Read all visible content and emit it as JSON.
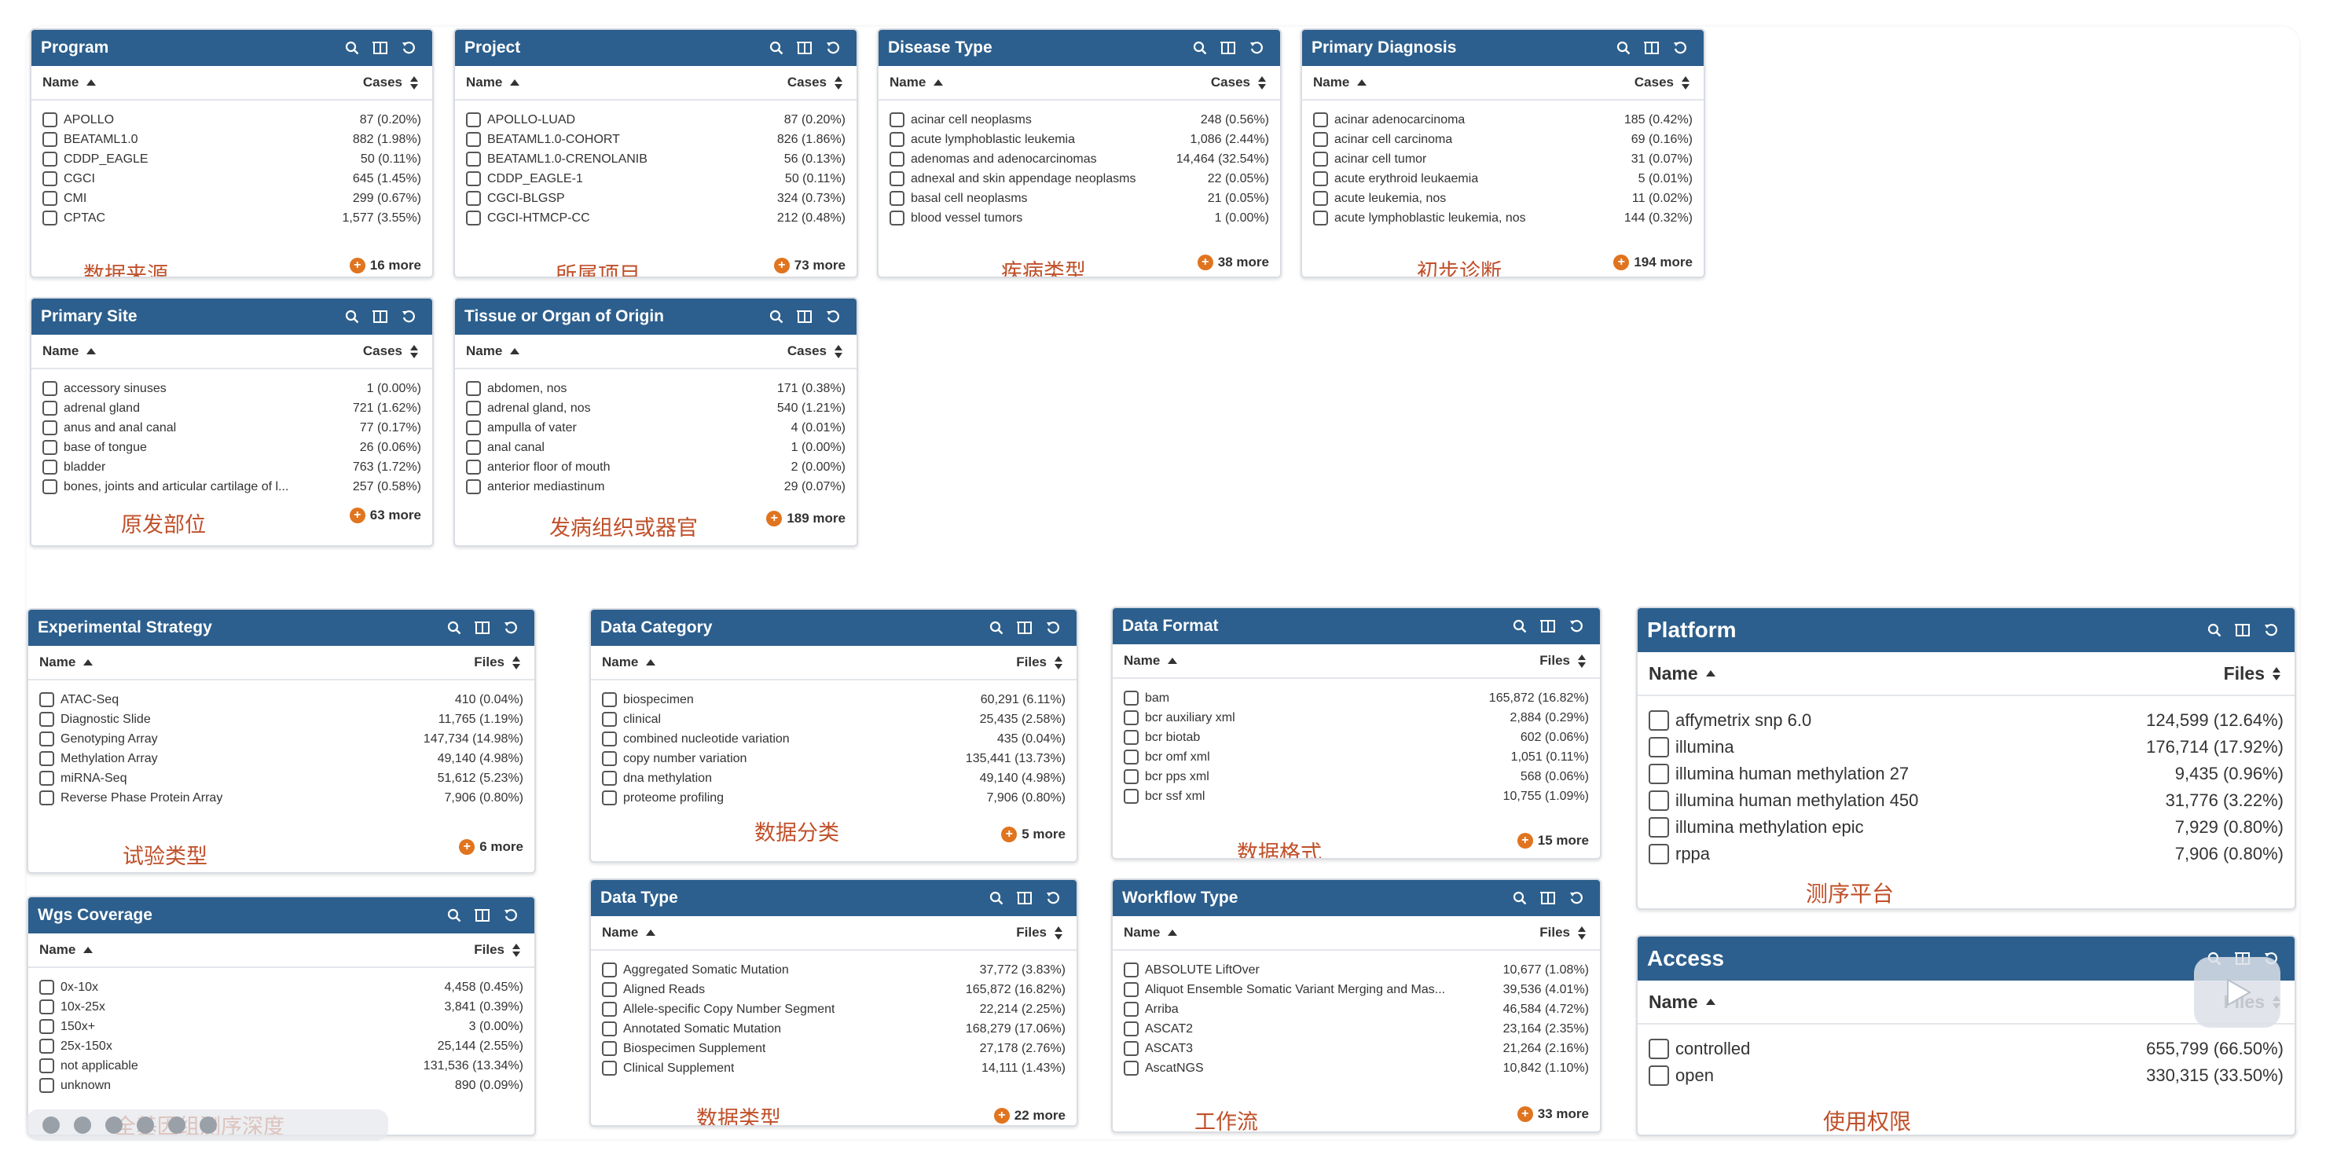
{
  "cards": {
    "program": {
      "title": "Program",
      "col_name": "Name",
      "col_count": "Cases",
      "rows": [
        {
          "name": "APOLLO",
          "count": "87 (0.20%)"
        },
        {
          "name": "BEATAML1.0",
          "count": "882 (1.98%)"
        },
        {
          "name": "CDDP_EAGLE",
          "count": "50 (0.11%)"
        },
        {
          "name": "CGCI",
          "count": "645 (1.45%)"
        },
        {
          "name": "CMI",
          "count": "299 (0.67%)"
        },
        {
          "name": "CPTAC",
          "count": "1,577 (3.55%)"
        }
      ],
      "more": "16 more",
      "annotation": "数据来源"
    },
    "project": {
      "title": "Project",
      "col_name": "Name",
      "col_count": "Cases",
      "rows": [
        {
          "name": "APOLLO-LUAD",
          "count": "87 (0.20%)"
        },
        {
          "name": "BEATAML1.0-COHORT",
          "count": "826 (1.86%)"
        },
        {
          "name": "BEATAML1.0-CRENOLANIB",
          "count": "56 (0.13%)"
        },
        {
          "name": "CDDP_EAGLE-1",
          "count": "50 (0.11%)"
        },
        {
          "name": "CGCI-BLGSP",
          "count": "324 (0.73%)"
        },
        {
          "name": "CGCI-HTMCP-CC",
          "count": "212 (0.48%)"
        }
      ],
      "more": "73 more",
      "annotation": "所属项目"
    },
    "disease_type": {
      "title": "Disease Type",
      "col_name": "Name",
      "col_count": "Cases",
      "rows": [
        {
          "name": "acinar cell neoplasms",
          "count": "248 (0.56%)"
        },
        {
          "name": "acute lymphoblastic leukemia",
          "count": "1,086 (2.44%)"
        },
        {
          "name": "adenomas and adenocarcinomas",
          "count": "14,464 (32.54%)"
        },
        {
          "name": "adnexal and skin appendage neoplasms",
          "count": "22 (0.05%)"
        },
        {
          "name": "basal cell neoplasms",
          "count": "21 (0.05%)"
        },
        {
          "name": "blood vessel tumors",
          "count": "1 (0.00%)"
        }
      ],
      "more": "38 more",
      "annotation": "疾病类型"
    },
    "primary_diagnosis": {
      "title": "Primary Diagnosis",
      "col_name": "Name",
      "col_count": "Cases",
      "rows": [
        {
          "name": "acinar adenocarcinoma",
          "count": "185 (0.42%)"
        },
        {
          "name": "acinar cell carcinoma",
          "count": "69 (0.16%)"
        },
        {
          "name": "acinar cell tumor",
          "count": "31 (0.07%)"
        },
        {
          "name": "acute erythroid leukaemia",
          "count": "5 (0.01%)"
        },
        {
          "name": "acute leukemia, nos",
          "count": "11 (0.02%)"
        },
        {
          "name": "acute lymphoblastic leukemia, nos",
          "count": "144 (0.32%)"
        }
      ],
      "more": "194 more",
      "annotation": "初步诊断"
    },
    "primary_site": {
      "title": "Primary Site",
      "col_name": "Name",
      "col_count": "Cases",
      "rows": [
        {
          "name": "accessory sinuses",
          "count": "1 (0.00%)"
        },
        {
          "name": "adrenal gland",
          "count": "721 (1.62%)"
        },
        {
          "name": "anus and anal canal",
          "count": "77 (0.17%)"
        },
        {
          "name": "base of tongue",
          "count": "26 (0.06%)"
        },
        {
          "name": "bladder",
          "count": "763 (1.72%)"
        },
        {
          "name": "bones, joints and articular cartilage of l...",
          "count": "257 (0.58%)"
        }
      ],
      "more": "63 more",
      "annotation": "原发部位"
    },
    "tissue_origin": {
      "title": "Tissue or Organ of Origin",
      "col_name": "Name",
      "col_count": "Cases",
      "rows": [
        {
          "name": "abdomen, nos",
          "count": "171 (0.38%)"
        },
        {
          "name": "adrenal gland, nos",
          "count": "540 (1.21%)"
        },
        {
          "name": "ampulla of vater",
          "count": "4 (0.01%)"
        },
        {
          "name": "anal canal",
          "count": "1 (0.00%)"
        },
        {
          "name": "anterior floor of mouth",
          "count": "2 (0.00%)"
        },
        {
          "name": "anterior mediastinum",
          "count": "29 (0.07%)"
        }
      ],
      "more": "189 more",
      "annotation": "发病组织或器官"
    },
    "experimental_strategy": {
      "title": "Experimental Strategy",
      "col_name": "Name",
      "col_count": "Files",
      "rows": [
        {
          "name": "ATAC-Seq",
          "count": "410 (0.04%)"
        },
        {
          "name": "Diagnostic Slide",
          "count": "11,765 (1.19%)"
        },
        {
          "name": "Genotyping Array",
          "count": "147,734 (14.98%)"
        },
        {
          "name": "Methylation Array",
          "count": "49,140 (4.98%)"
        },
        {
          "name": "miRNA-Seq",
          "count": "51,612 (5.23%)"
        },
        {
          "name": "Reverse Phase Protein Array",
          "count": "7,906 (0.80%)"
        }
      ],
      "more": "6 more",
      "annotation": "试验类型"
    },
    "data_category": {
      "title": "Data Category",
      "col_name": "Name",
      "col_count": "Files",
      "rows": [
        {
          "name": "biospecimen",
          "count": "60,291 (6.11%)"
        },
        {
          "name": "clinical",
          "count": "25,435 (2.58%)"
        },
        {
          "name": "combined nucleotide variation",
          "count": "435 (0.04%)"
        },
        {
          "name": "copy number variation",
          "count": "135,441 (13.73%)"
        },
        {
          "name": "dna methylation",
          "count": "49,140 (4.98%)"
        },
        {
          "name": "proteome profiling",
          "count": "7,906 (0.80%)"
        }
      ],
      "more": "5 more",
      "annotation": "数据分类"
    },
    "data_format": {
      "title": "Data Format",
      "col_name": "Name",
      "col_count": "Files",
      "rows": [
        {
          "name": "bam",
          "count": "165,872 (16.82%)"
        },
        {
          "name": "bcr auxiliary xml",
          "count": "2,884 (0.29%)"
        },
        {
          "name": "bcr biotab",
          "count": "602 (0.06%)"
        },
        {
          "name": "bcr omf xml",
          "count": "1,051 (0.11%)"
        },
        {
          "name": "bcr pps xml",
          "count": "568 (0.06%)"
        },
        {
          "name": "bcr ssf xml",
          "count": "10,755 (1.09%)"
        }
      ],
      "more": "15 more",
      "annotation": "数据格式"
    },
    "platform": {
      "title": "Platform",
      "col_name": "Name",
      "col_count": "Files",
      "rows": [
        {
          "name": "affymetrix snp 6.0",
          "count": "124,599 (12.64%)"
        },
        {
          "name": "illumina",
          "count": "176,714 (17.92%)"
        },
        {
          "name": "illumina human methylation 27",
          "count": "9,435 (0.96%)"
        },
        {
          "name": "illumina human methylation 450",
          "count": "31,776 (3.22%)"
        },
        {
          "name": "illumina methylation epic",
          "count": "7,929 (0.80%)"
        },
        {
          "name": "rppa",
          "count": "7,906 (0.80%)"
        }
      ],
      "annotation": "测序平台"
    },
    "wgs_coverage": {
      "title": "Wgs Coverage",
      "col_name": "Name",
      "col_count": "Files",
      "rows": [
        {
          "name": "0x-10x",
          "count": "4,458 (0.45%)"
        },
        {
          "name": "10x-25x",
          "count": "3,841 (0.39%)"
        },
        {
          "name": "150x+",
          "count": "3 (0.00%)"
        },
        {
          "name": "25x-150x",
          "count": "25,144 (2.55%)"
        },
        {
          "name": "not applicable",
          "count": "131,536 (13.34%)"
        },
        {
          "name": "unknown",
          "count": "890 (0.09%)"
        }
      ],
      "annotation": "全基因组测序深度"
    },
    "data_type": {
      "title": "Data Type",
      "col_name": "Name",
      "col_count": "Files",
      "rows": [
        {
          "name": "Aggregated Somatic Mutation",
          "count": "37,772 (3.83%)"
        },
        {
          "name": "Aligned Reads",
          "count": "165,872 (16.82%)"
        },
        {
          "name": "Allele-specific Copy Number Segment",
          "count": "22,214 (2.25%)"
        },
        {
          "name": "Annotated Somatic Mutation",
          "count": "168,279 (17.06%)"
        },
        {
          "name": "Biospecimen Supplement",
          "count": "27,178 (2.76%)"
        },
        {
          "name": "Clinical Supplement",
          "count": "14,111 (1.43%)"
        }
      ],
      "more": "22 more",
      "annotation": "数据类型"
    },
    "workflow_type": {
      "title": "Workflow Type",
      "col_name": "Name",
      "col_count": "Files",
      "rows": [
        {
          "name": "ABSOLUTE LiftOver",
          "count": "10,677 (1.08%)"
        },
        {
          "name": "Aliquot Ensemble Somatic Variant Merging and Mas...",
          "count": "39,536 (4.01%)"
        },
        {
          "name": "Arriba",
          "count": "46,584 (4.72%)"
        },
        {
          "name": "ASCAT2",
          "count": "23,164 (2.35%)"
        },
        {
          "name": "ASCAT3",
          "count": "21,264 (2.16%)"
        },
        {
          "name": "AscatNGS",
          "count": "10,842 (1.10%)"
        }
      ],
      "more": "33 more",
      "annotation": "工作流"
    },
    "access": {
      "title": "Access",
      "col_name": "Name",
      "col_count": "Files",
      "rows": [
        {
          "name": "controlled",
          "count": "655,799 (66.50%)"
        },
        {
          "name": "open",
          "count": "330,315 (33.50%)"
        }
      ],
      "annotation": "使用权限"
    }
  },
  "colors": {
    "header": "#2c5f8d",
    "more_icon": "#e0741f",
    "annotation": "#c0502a"
  },
  "icons": [
    "search-icon",
    "column-toggle-icon",
    "reset-icon",
    "plus-circle-icon",
    "sort-ascending-icon",
    "sort-toggle-icon",
    "play-icon"
  ]
}
